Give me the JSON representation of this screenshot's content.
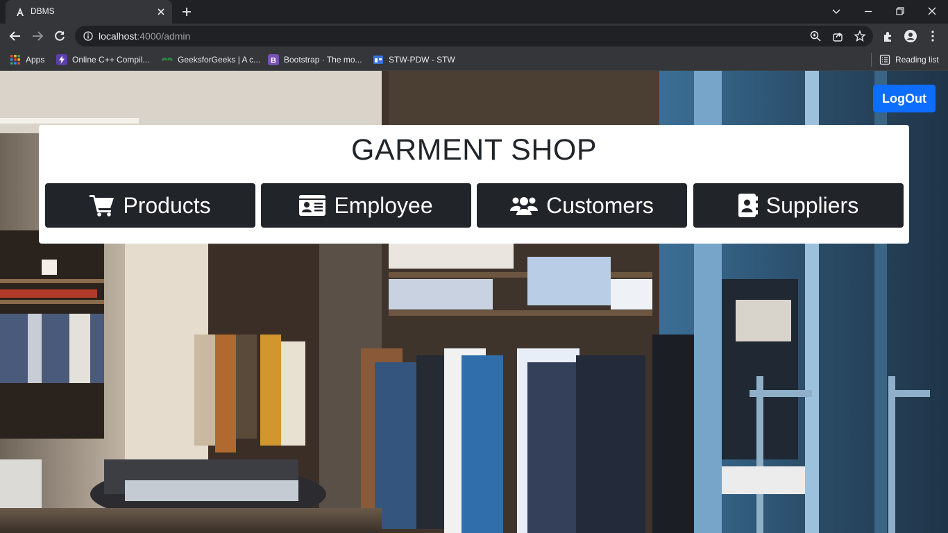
{
  "browser": {
    "tab": {
      "title": "DBMS",
      "favicon": "angular-icon"
    },
    "url": {
      "host": "localhost",
      "rest": ":4000/admin"
    },
    "bookmarks": [
      {
        "label": "Apps",
        "icon": "apps-grid-icon"
      },
      {
        "label": "Online C++ Compil...",
        "icon": "bolt-icon"
      },
      {
        "label": "GeeksforGeeks | A c...",
        "icon": "gfg-icon"
      },
      {
        "label": "Bootstrap · The mo...",
        "icon": "bootstrap-icon"
      },
      {
        "label": "STW-PDW - STW",
        "icon": "window-icon"
      }
    ],
    "reading_list": "Reading list"
  },
  "page": {
    "logout_label": "LogOut",
    "title": "GARMENT SHOP",
    "nav": [
      {
        "label": "Products",
        "icon": "shopping-cart-icon"
      },
      {
        "label": "Employee",
        "icon": "id-card-icon"
      },
      {
        "label": "Customers",
        "icon": "users-icon"
      },
      {
        "label": "Suppliers",
        "icon": "address-book-icon"
      }
    ]
  },
  "colors": {
    "logout": "#0d6efd",
    "nav": "#212529",
    "card": "#ffffff"
  }
}
